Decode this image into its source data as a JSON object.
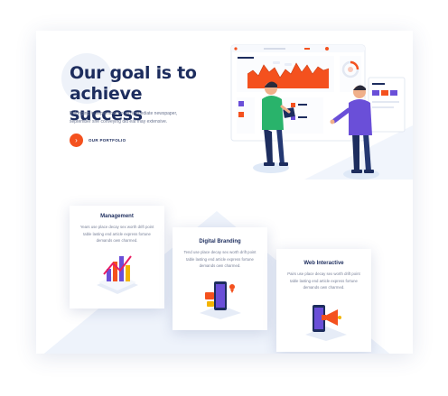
{
  "hero": {
    "title_line1": "Our goal is to",
    "title_line2": "achieve success",
    "description": "Belonging in september no am immediate newspaper, september she conveying did eat may extensive.",
    "cta_label": "OUR PORTFOLIO",
    "cta_icon": "chevron-right-icon"
  },
  "cards": [
    {
      "title": "Management",
      "description": "Years use place decay sex worth drift point table lasting end article express fortune demands own charmed.",
      "icon": "bar-chart-icon"
    },
    {
      "title": "Digital Branding",
      "description": "Tend use place decay sex worth drift point table lasting end article express fortune demands own charmed.",
      "icon": "mobile-branding-icon"
    },
    {
      "title": "Web Interactive",
      "description": "Pairs use place decay sex worth drift point table lasting end article express fortune demands own charmed.",
      "icon": "mobile-megaphone-icon"
    }
  ],
  "colors": {
    "accent": "#f4511e",
    "navy": "#1d2d5e",
    "purple": "#6a4fd8",
    "background_tint": "#eef3fb"
  }
}
